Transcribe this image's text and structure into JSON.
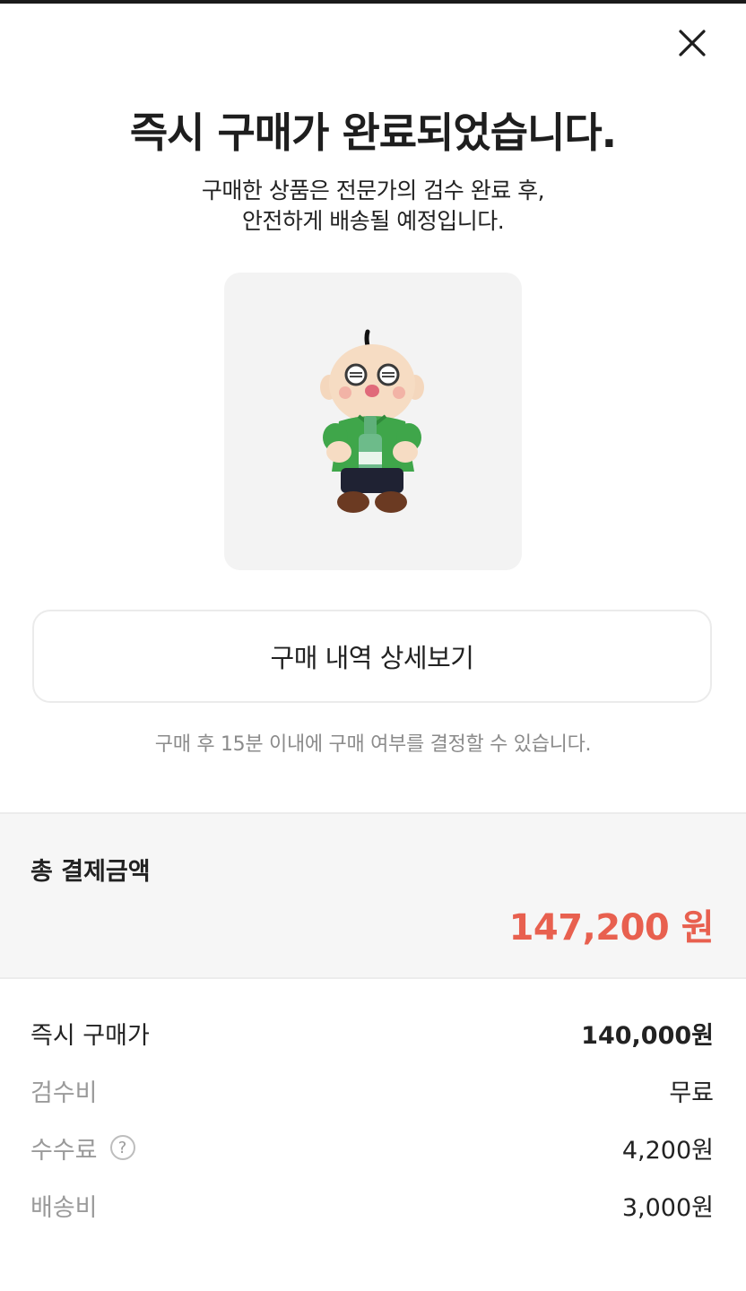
{
  "header": {
    "title": "즉시 구매가 완료되었습니다.",
    "subtitle_line1": "구매한 상품은 전문가의 검수 완료 후,",
    "subtitle_line2": "안전하게 배송될 예정입니다."
  },
  "close_icon": "close-icon",
  "product": {
    "image_icon": "plush-doll-figure"
  },
  "actions": {
    "detail_button_label": "구매 내역 상세보기"
  },
  "notice_text": "구매 후 15분 이내에 구매 여부를 결정할 수 있습니다.",
  "total": {
    "label": "총 결제금액",
    "amount": "147,200 원",
    "accent_color": "#e8604f"
  },
  "breakdown": [
    {
      "label": "즉시 구매가",
      "value": "140,000원"
    },
    {
      "label": "검수비",
      "value": "무료"
    },
    {
      "label": "수수료",
      "value": "4,200원",
      "help_icon": "?"
    },
    {
      "label": "배송비",
      "value": "3,000원"
    }
  ]
}
